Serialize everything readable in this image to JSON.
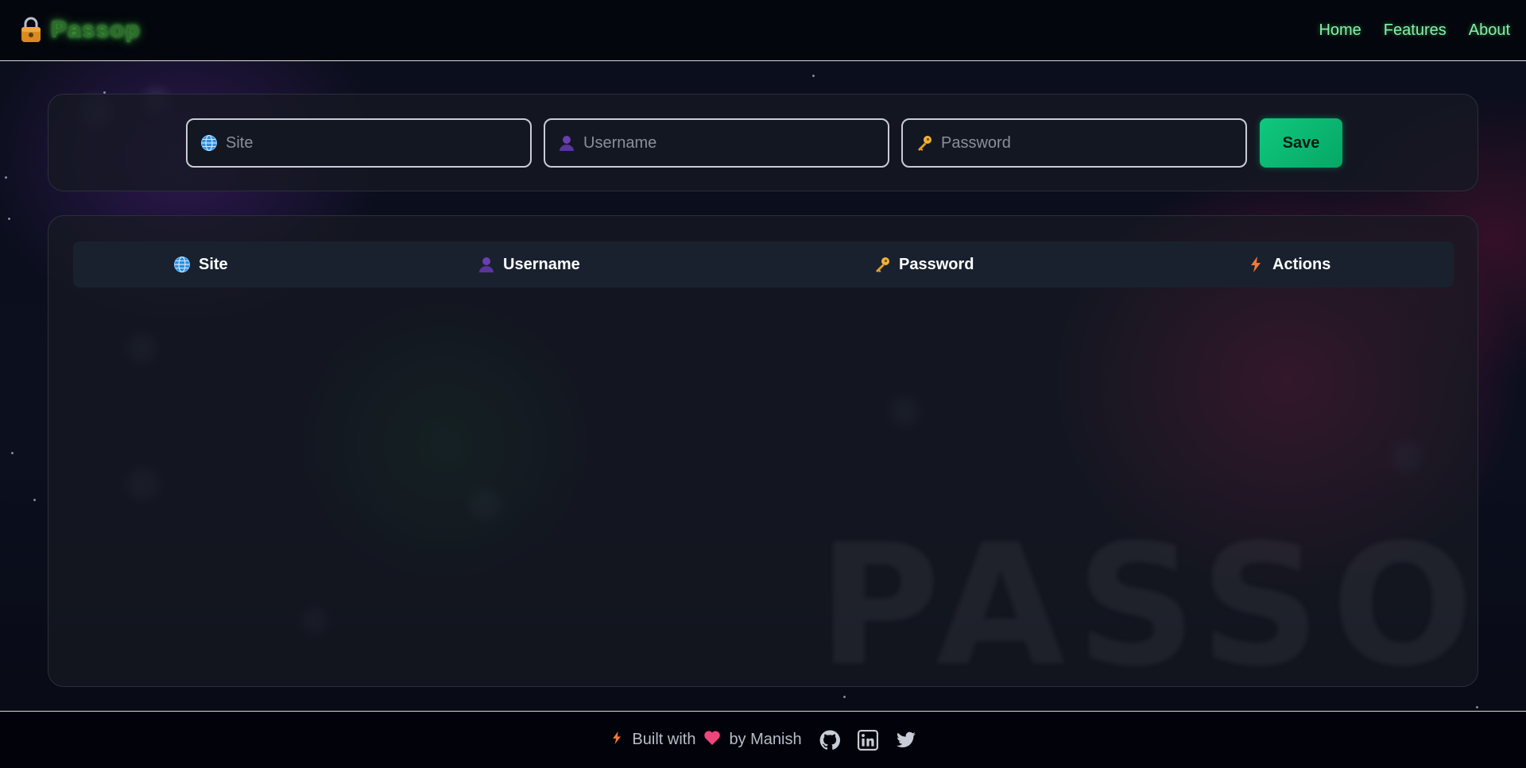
{
  "brand": {
    "title": "Passop"
  },
  "nav": {
    "items": [
      "Home",
      "Features",
      "About"
    ]
  },
  "form": {
    "site_placeholder": "Site",
    "username_placeholder": "Username",
    "password_placeholder": "Password",
    "save_label": "Save"
  },
  "table": {
    "headers": [
      "Site",
      "Username",
      "Password",
      "Actions"
    ],
    "rows": [],
    "watermark": "PASSOP"
  },
  "footer": {
    "built_with": "Built with",
    "by": "by Manish",
    "social": [
      "github-icon",
      "linkedin-icon",
      "twitter-icon"
    ]
  },
  "colors": {
    "accent_green": "#10c77e",
    "nav_link": "#86efac",
    "brand_glow": "#5ad85a"
  }
}
